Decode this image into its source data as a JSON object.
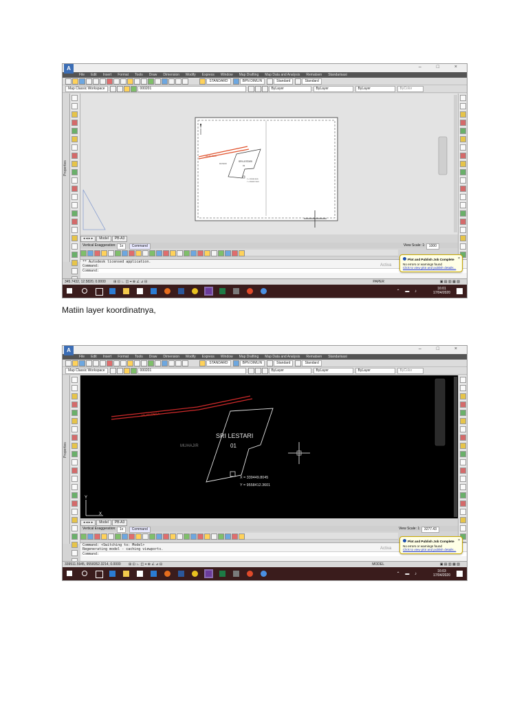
{
  "caption": "Matiin layer koordinatnya,",
  "menu": [
    "File",
    "Edit",
    "Insert",
    "Format",
    "Tools",
    "Draw",
    "Dimension",
    "Modify",
    "Express",
    "Window",
    "Map Drafting",
    "Map Data and Analysis",
    "Rematsen",
    "Standarisasi"
  ],
  "toolbar": {
    "style1": "STANDARD",
    "style2": "BPN DIMLIN",
    "style3": "Standard",
    "style4": "Standard",
    "workspace": "Map Classic Workspace",
    "layer": "000201",
    "color": "ByLayer",
    "linetype": "ByLayer",
    "lineweight": "ByLayer",
    "plotstyle": "ByColor"
  },
  "panel_label": "Properties",
  "tabs": {
    "model": "Model",
    "layout": "PB-A3"
  },
  "toast": {
    "title": "Plot and Publish Job Complete",
    "line1": "No errors or warnings found",
    "link": "Click to view plot and publish details..."
  },
  "status": {
    "vertical_exaggeration": "Vertical Exaggeration:",
    "vexag_value": "1x",
    "command_btn": "Command"
  },
  "shot1": {
    "command_lines": [
      "** Autodesk licensed application.",
      "Command:",
      "Command:"
    ],
    "coords": "345.7432, 12.5820, 0.0000",
    "view_scale": "View Scale: 1:",
    "view_scale_value": "1000",
    "paper": "PAPER",
    "activate": "Activa",
    "clock_time": "16:01",
    "clock_date": "17/04/2020",
    "drawing": {
      "road": "JALAN DESA",
      "parcel_name": "SRI LESTARI",
      "parcel_num": "01",
      "neighbor": "MUHAJIR",
      "x": "X = 339449.8045",
      "y": "Y = 9558412.3601"
    }
  },
  "shot2": {
    "command_lines": [
      "Command:  <Switching to: Model>",
      "Regenerating model - caching viewports.",
      "Command:"
    ],
    "coords": "339511.5945, 9558352.3214, 0.0000",
    "view_scale": "View Scale: 1:",
    "view_scale_value": "3277.43",
    "paper": "MODEL",
    "activate": "Activa",
    "clock_time": "16:03",
    "clock_date": "17/04/2020",
    "drawing": {
      "road": "JALAN DESA",
      "parcel_name": "SRI LESTARI",
      "parcel_num": "01",
      "neighbor": "MUHAJIR",
      "x": "X = 339449.8045",
      "y": "Y = 9558412.3601",
      "ucs_x": "X",
      "ucs_y": "Y"
    }
  }
}
